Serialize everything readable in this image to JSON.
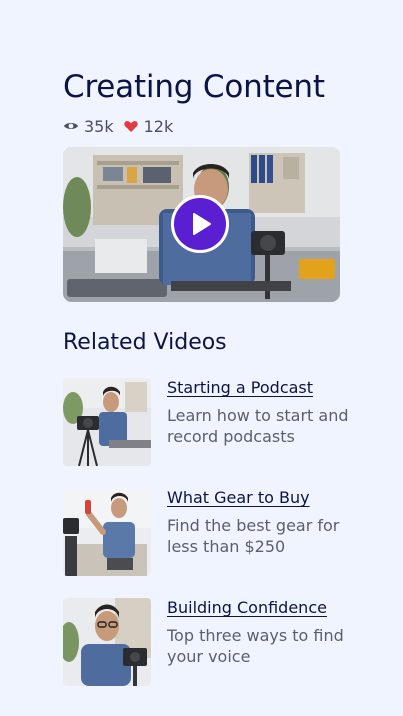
{
  "header": {
    "title": "Creating Content",
    "views": "35k",
    "likes": "12k",
    "views_icon": "eye-icon",
    "likes_icon": "heart-icon",
    "like_color": "#e6393f"
  },
  "video": {
    "play_icon": "play-icon",
    "accent": "#5a1fd1"
  },
  "related": {
    "heading": "Related Videos",
    "items": [
      {
        "title": "Starting a Podcast",
        "description": "Learn how to start and record podcasts"
      },
      {
        "title": "What Gear to Buy",
        "description": "Find the best gear for less than $250"
      },
      {
        "title": "Building Confidence",
        "description": "Top three ways to find your voice"
      }
    ]
  }
}
